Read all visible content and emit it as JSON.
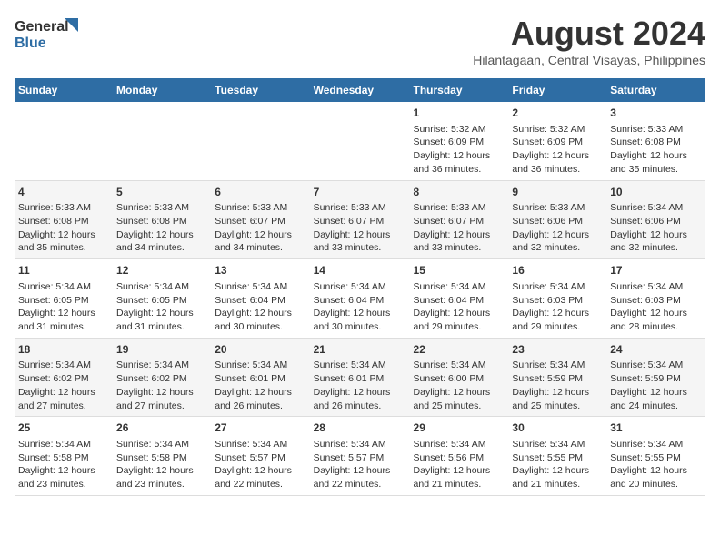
{
  "header": {
    "logo_line1": "General",
    "logo_line2": "Blue",
    "month": "August 2024",
    "location": "Hilantagaan, Central Visayas, Philippines"
  },
  "days_of_week": [
    "Sunday",
    "Monday",
    "Tuesday",
    "Wednesday",
    "Thursday",
    "Friday",
    "Saturday"
  ],
  "weeks": [
    [
      {
        "day": "",
        "info": ""
      },
      {
        "day": "",
        "info": ""
      },
      {
        "day": "",
        "info": ""
      },
      {
        "day": "",
        "info": ""
      },
      {
        "day": "1",
        "info": "Sunrise: 5:32 AM\nSunset: 6:09 PM\nDaylight: 12 hours and 36 minutes."
      },
      {
        "day": "2",
        "info": "Sunrise: 5:32 AM\nSunset: 6:09 PM\nDaylight: 12 hours and 36 minutes."
      },
      {
        "day": "3",
        "info": "Sunrise: 5:33 AM\nSunset: 6:08 PM\nDaylight: 12 hours and 35 minutes."
      }
    ],
    [
      {
        "day": "4",
        "info": "Sunrise: 5:33 AM\nSunset: 6:08 PM\nDaylight: 12 hours and 35 minutes."
      },
      {
        "day": "5",
        "info": "Sunrise: 5:33 AM\nSunset: 6:08 PM\nDaylight: 12 hours and 34 minutes."
      },
      {
        "day": "6",
        "info": "Sunrise: 5:33 AM\nSunset: 6:07 PM\nDaylight: 12 hours and 34 minutes."
      },
      {
        "day": "7",
        "info": "Sunrise: 5:33 AM\nSunset: 6:07 PM\nDaylight: 12 hours and 33 minutes."
      },
      {
        "day": "8",
        "info": "Sunrise: 5:33 AM\nSunset: 6:07 PM\nDaylight: 12 hours and 33 minutes."
      },
      {
        "day": "9",
        "info": "Sunrise: 5:33 AM\nSunset: 6:06 PM\nDaylight: 12 hours and 32 minutes."
      },
      {
        "day": "10",
        "info": "Sunrise: 5:34 AM\nSunset: 6:06 PM\nDaylight: 12 hours and 32 minutes."
      }
    ],
    [
      {
        "day": "11",
        "info": "Sunrise: 5:34 AM\nSunset: 6:05 PM\nDaylight: 12 hours and 31 minutes."
      },
      {
        "day": "12",
        "info": "Sunrise: 5:34 AM\nSunset: 6:05 PM\nDaylight: 12 hours and 31 minutes."
      },
      {
        "day": "13",
        "info": "Sunrise: 5:34 AM\nSunset: 6:04 PM\nDaylight: 12 hours and 30 minutes."
      },
      {
        "day": "14",
        "info": "Sunrise: 5:34 AM\nSunset: 6:04 PM\nDaylight: 12 hours and 30 minutes."
      },
      {
        "day": "15",
        "info": "Sunrise: 5:34 AM\nSunset: 6:04 PM\nDaylight: 12 hours and 29 minutes."
      },
      {
        "day": "16",
        "info": "Sunrise: 5:34 AM\nSunset: 6:03 PM\nDaylight: 12 hours and 29 minutes."
      },
      {
        "day": "17",
        "info": "Sunrise: 5:34 AM\nSunset: 6:03 PM\nDaylight: 12 hours and 28 minutes."
      }
    ],
    [
      {
        "day": "18",
        "info": "Sunrise: 5:34 AM\nSunset: 6:02 PM\nDaylight: 12 hours and 27 minutes."
      },
      {
        "day": "19",
        "info": "Sunrise: 5:34 AM\nSunset: 6:02 PM\nDaylight: 12 hours and 27 minutes."
      },
      {
        "day": "20",
        "info": "Sunrise: 5:34 AM\nSunset: 6:01 PM\nDaylight: 12 hours and 26 minutes."
      },
      {
        "day": "21",
        "info": "Sunrise: 5:34 AM\nSunset: 6:01 PM\nDaylight: 12 hours and 26 minutes."
      },
      {
        "day": "22",
        "info": "Sunrise: 5:34 AM\nSunset: 6:00 PM\nDaylight: 12 hours and 25 minutes."
      },
      {
        "day": "23",
        "info": "Sunrise: 5:34 AM\nSunset: 5:59 PM\nDaylight: 12 hours and 25 minutes."
      },
      {
        "day": "24",
        "info": "Sunrise: 5:34 AM\nSunset: 5:59 PM\nDaylight: 12 hours and 24 minutes."
      }
    ],
    [
      {
        "day": "25",
        "info": "Sunrise: 5:34 AM\nSunset: 5:58 PM\nDaylight: 12 hours and 23 minutes."
      },
      {
        "day": "26",
        "info": "Sunrise: 5:34 AM\nSunset: 5:58 PM\nDaylight: 12 hours and 23 minutes."
      },
      {
        "day": "27",
        "info": "Sunrise: 5:34 AM\nSunset: 5:57 PM\nDaylight: 12 hours and 22 minutes."
      },
      {
        "day": "28",
        "info": "Sunrise: 5:34 AM\nSunset: 5:57 PM\nDaylight: 12 hours and 22 minutes."
      },
      {
        "day": "29",
        "info": "Sunrise: 5:34 AM\nSunset: 5:56 PM\nDaylight: 12 hours and 21 minutes."
      },
      {
        "day": "30",
        "info": "Sunrise: 5:34 AM\nSunset: 5:55 PM\nDaylight: 12 hours and 21 minutes."
      },
      {
        "day": "31",
        "info": "Sunrise: 5:34 AM\nSunset: 5:55 PM\nDaylight: 12 hours and 20 minutes."
      }
    ]
  ]
}
